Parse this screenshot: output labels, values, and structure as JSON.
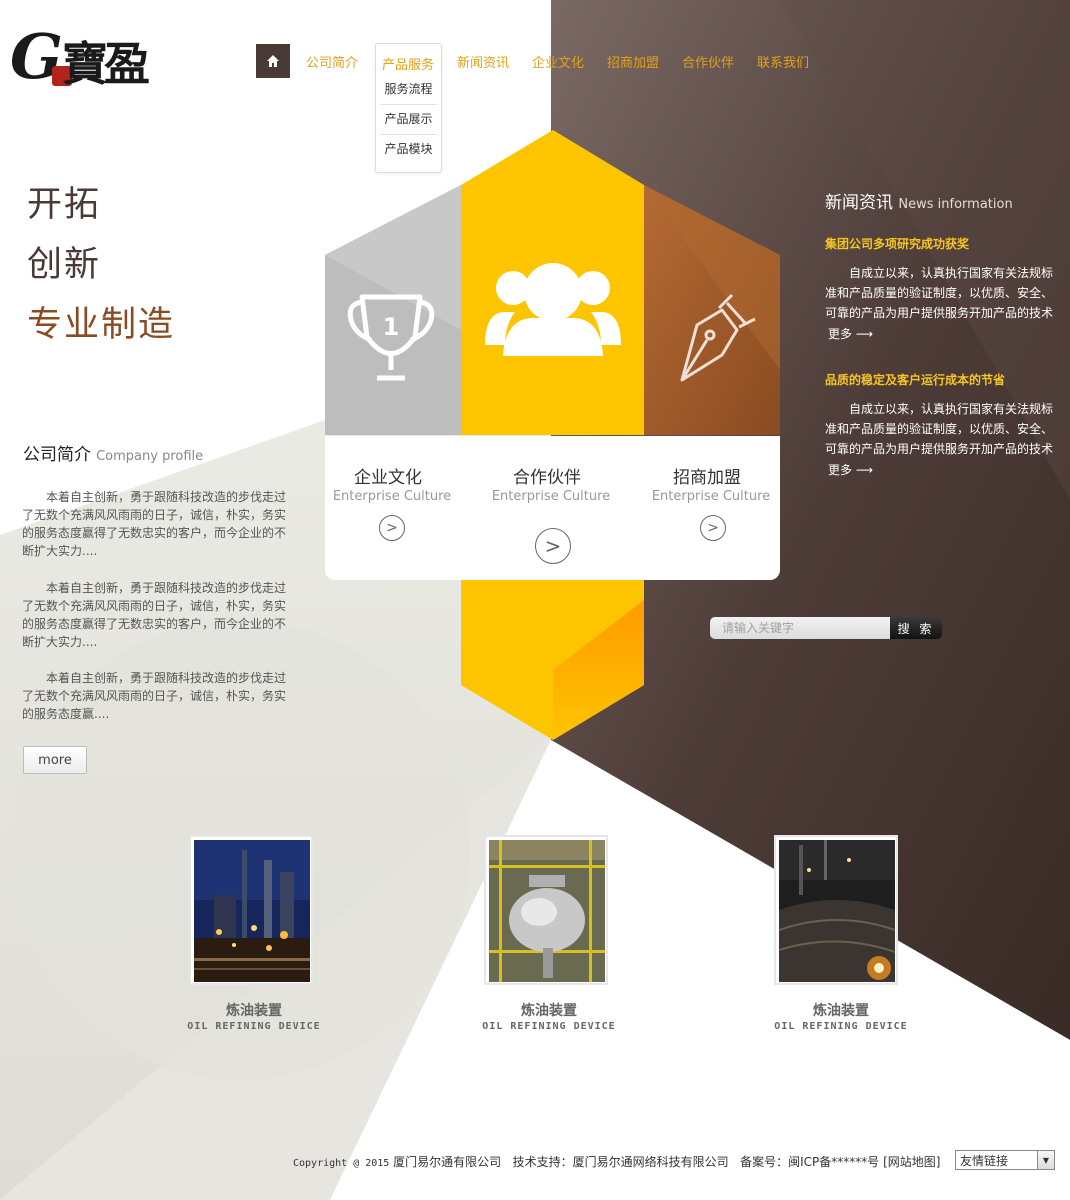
{
  "colors": {
    "brown_dark": "#4a3a36",
    "gold": "#f5c500",
    "gold_nav": "#e0a21a",
    "copper": "#a55f2f",
    "gray_hex": "#bdbdbd",
    "accent_brown": "#8a4b22"
  },
  "logo": {
    "letter": "G",
    "text": "寶盈"
  },
  "nav": {
    "home_icon": "home-icon",
    "items": [
      "公司简介",
      "产品服务",
      "新闻资讯",
      "企业文化",
      "招商加盟",
      "合作伙伴",
      "联系我们"
    ],
    "dropdown": [
      "服务流程",
      "产品展示",
      "产品模块"
    ]
  },
  "slogan": [
    "开拓",
    "创新",
    "专业制造"
  ],
  "hexagon": {
    "icons": [
      "trophy-icon",
      "people-icon",
      "pen-nib-icon"
    ],
    "trophy_number": "1",
    "captions": [
      {
        "cn": "企业文化",
        "en": "Enterprise Culture"
      },
      {
        "cn": "合作伙伴",
        "en": "Enterprise Culture"
      },
      {
        "cn": "招商加盟",
        "en": "Enterprise Culture"
      }
    ]
  },
  "company": {
    "title": "公司简介",
    "title_en": "Company profile",
    "paragraphs": [
      "本着自主创新，勇于跟随科技改造的步伐走过了无数个充满风风雨雨的日子，诚信，朴实，务实的服务态度赢得了无数忠实的客户，而今企业的不断扩大实力....",
      "本着自主创新，勇于跟随科技改造的步伐走过了无数个充满风风雨雨的日子，诚信，朴实，务实的服务态度赢得了无数忠实的客户，而今企业的不断扩大实力....",
      "本着自主创新，勇于跟随科技改造的步伐走过了无数个充满风风雨雨的日子，诚信，朴实，务实的服务态度赢...."
    ],
    "more": "more"
  },
  "news": {
    "title": "新闻资讯",
    "title_en": "News information",
    "items": [
      {
        "headline": "集团公司多项研究成功获奖",
        "body": "自成立以来，认真执行国家有关法规标准和产品质量的验证制度，以优质、安全、可靠的产品为用户提供服务开加产品的技术",
        "more": "更多"
      },
      {
        "headline": "品质的稳定及客户运行成本的节省",
        "body": "自成立以来，认真执行国家有关法规标准和产品质量的验证制度，以优质、安全、可靠的产品为用户提供服务开加产品的技术",
        "more": "更多"
      }
    ]
  },
  "search": {
    "placeholder": "请输入关键字",
    "button": "搜 索"
  },
  "products": [
    {
      "cn": "炼油装置",
      "en": "OIL REFINING DEVICE"
    },
    {
      "cn": "炼油装置",
      "en": "OIL REFINING DEVICE"
    },
    {
      "cn": "炼油装置",
      "en": "OIL REFINING DEVICE"
    }
  ],
  "footer": {
    "copyright": "Copyright @ 2015",
    "company": "厦门易尔通有限公司",
    "tech": "技术支持：厦门易尔通网络科技有限公司",
    "icp": "备案号：闽ICP备******号",
    "sitemap": "[网站地图]",
    "friend_links": "友情链接"
  }
}
